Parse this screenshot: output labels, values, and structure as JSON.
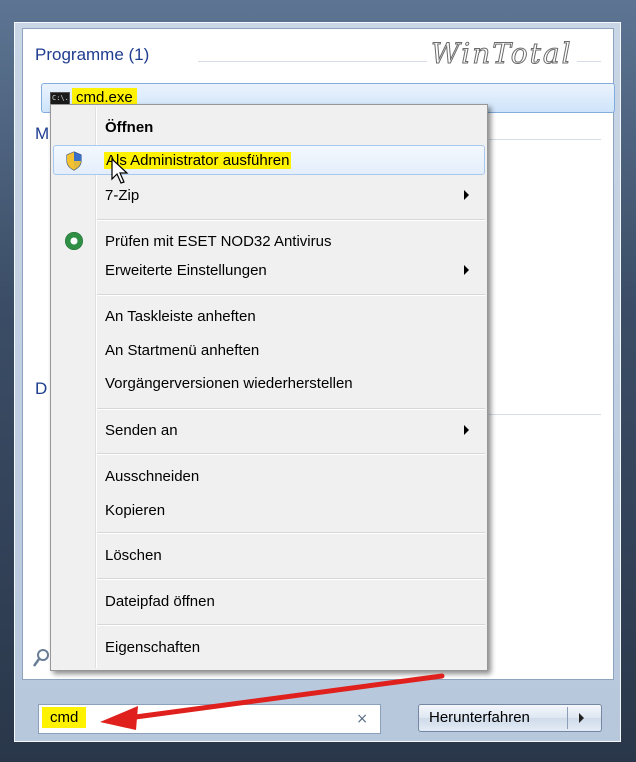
{
  "results": {
    "programs_header": "Programme (1)",
    "watermark": "WinTotal",
    "program_item": {
      "label": "cmd.exe",
      "icon_text": "C:\\."
    },
    "stub_m": "M",
    "stub_d": "D"
  },
  "context_menu": {
    "items": [
      {
        "label": "Öffnen",
        "bold": true
      },
      {
        "label": "Als Administrator ausführen",
        "icon": "uac-shield-icon",
        "highlighted": true
      },
      {
        "label": "7-Zip",
        "submenu": true
      },
      {
        "label": "Prüfen mit ESET NOD32 Antivirus",
        "icon": "eset-icon"
      },
      {
        "label": "Erweiterte Einstellungen",
        "submenu": true
      },
      {
        "label": "An Taskleiste anheften"
      },
      {
        "label": "An Startmenü anheften"
      },
      {
        "label": "Vorgängerversionen wiederherstellen"
      },
      {
        "label": "Senden an",
        "submenu": true
      },
      {
        "label": "Ausschneiden"
      },
      {
        "label": "Kopieren"
      },
      {
        "label": "Löschen"
      },
      {
        "label": "Dateipfad öffnen"
      },
      {
        "label": "Eigenschaften"
      }
    ]
  },
  "search": {
    "value": "cmd",
    "clear_glyph": "×"
  },
  "shutdown": {
    "label": "Herunterfahren"
  },
  "colors": {
    "highlight": "#fff200",
    "arrow": "#e0201c",
    "header_text": "#1e3d8f"
  }
}
